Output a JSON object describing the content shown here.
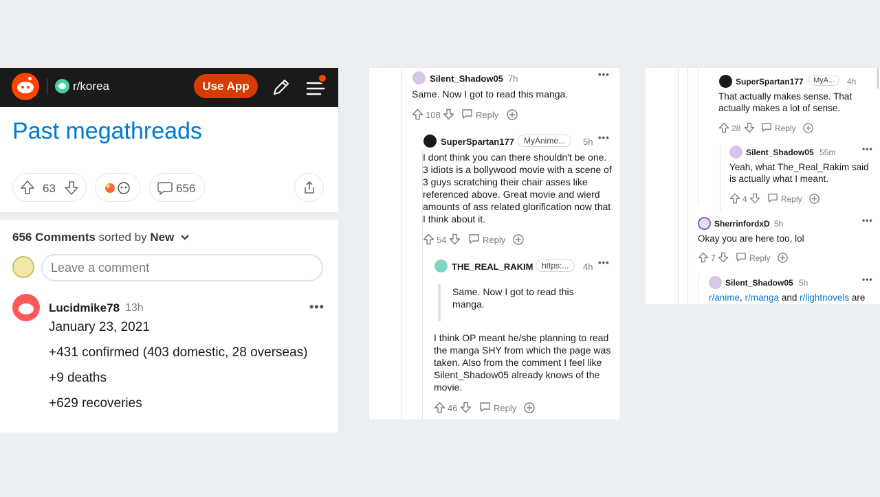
{
  "panel1": {
    "subreddit": "r/korea",
    "use_app": "Use App",
    "post_title": "Past megathreads",
    "votes": "63",
    "comments_count": "656",
    "sort": {
      "count_label": "656 Comments",
      "sorted_by": "sorted by",
      "mode": "New"
    },
    "comment_placeholder": "Leave a comment",
    "comment": {
      "user": "Lucidmike78",
      "time": "13h",
      "lines": [
        "January 23, 2021",
        "+431 confirmed (403 domestic, 28 overseas)",
        "+9 deaths",
        "+629 recoveries"
      ]
    }
  },
  "panel2": {
    "c1": {
      "user": "Silent_Shadow05",
      "time": "7h",
      "text": "Same. Now I got to read this manga.",
      "votes": "108",
      "reply": "Reply"
    },
    "c2": {
      "user": "SuperSpartan177",
      "flair": "MyAnime...",
      "time": "5h",
      "text": "I dont think you can there shouldn't be one. 3 idiots is a bollywood movie with a scene of 3 guys scratching their chair asses like referenced above. Great movie and wierd amounts of ass related glorification now that I think about it.",
      "votes": "54",
      "reply": "Reply"
    },
    "c3": {
      "user": "THE_REAL_RAKIM",
      "flair": "https:...",
      "time": "4h",
      "quote": "Same. Now I got to read this manga.",
      "text": "I think OP meant he/she planning to read the manga SHY from which the page was taken. Also from the comment I feel like Silent_Shadow05 already knows of the movie.",
      "votes": "46",
      "reply": "Reply"
    }
  },
  "panel3": {
    "c1": {
      "user": "SuperSpartan177",
      "flair": "MyA...",
      "time": "4h",
      "text": "That actually makes sense. That actually makes a lot of sense.",
      "votes": "28",
      "reply": "Reply"
    },
    "c2": {
      "user": "Silent_Shadow05",
      "time": "55m",
      "text": "Yeah, what The_Real_Rakim said is actually what I meant.",
      "votes": "4",
      "reply": "Reply"
    },
    "c3": {
      "user": "SherrinfordxD",
      "time": "5h",
      "text": "Okay you are here too, lol",
      "votes": "7",
      "reply": "Reply"
    },
    "c4": {
      "user": "Silent_Shadow05",
      "time": "5h",
      "link1": "r/anime",
      "sep1": ", ",
      "link2": "r/manga",
      "sep2": " and ",
      "link3": "r/lightnovels",
      "tail": " are"
    }
  },
  "colors": {
    "accent": "#0079d3",
    "orange": "#ff4500",
    "use_app_bg": "#d93a00",
    "header_bg": "#1a1a1b"
  }
}
